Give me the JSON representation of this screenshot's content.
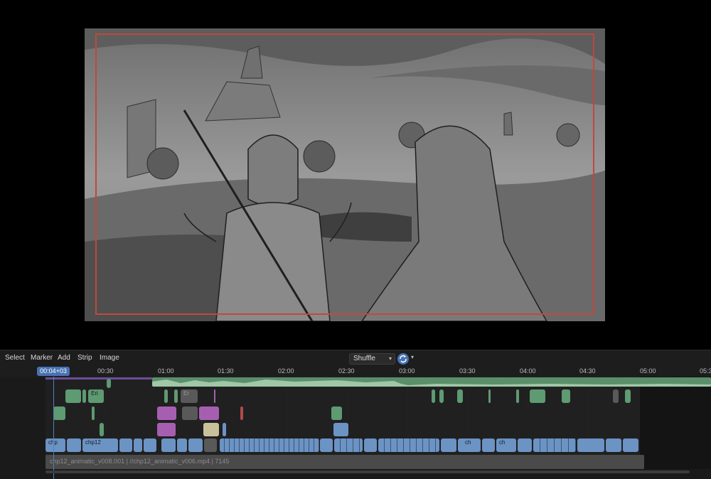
{
  "header": {
    "menu": [
      "Select",
      "Marker",
      "Add",
      "Strip",
      "Image"
    ],
    "overlay_mode": "Shuffle"
  },
  "ruler": {
    "current_time": "00:04+03",
    "ticks": [
      "00:30",
      "01:00",
      "01:30",
      "02:00",
      "02:30",
      "03:00",
      "03:30",
      "04:00",
      "04:30",
      "05:00",
      "05:3"
    ]
  },
  "strips": {
    "eri_1": "Eri",
    "er_2": "Er",
    "chp_1": "chp",
    "chp12": "chp12",
    "ch_1": "ch",
    "ch_2": "ch"
  },
  "movie_strip": {
    "label": "chp12_animatic_v008.001 | //chp12_animatic_v006.mp4 | 7145"
  },
  "colors": {
    "accent": "#4772b3",
    "safe_area": "#c0493a",
    "sound_strip": "#5a8f6a",
    "image_strip": "#6b93c4",
    "meta_strip": "#a65fb0"
  },
  "icons": {
    "sync": "sync-icon",
    "dropdown": "chevron-down-icon"
  }
}
